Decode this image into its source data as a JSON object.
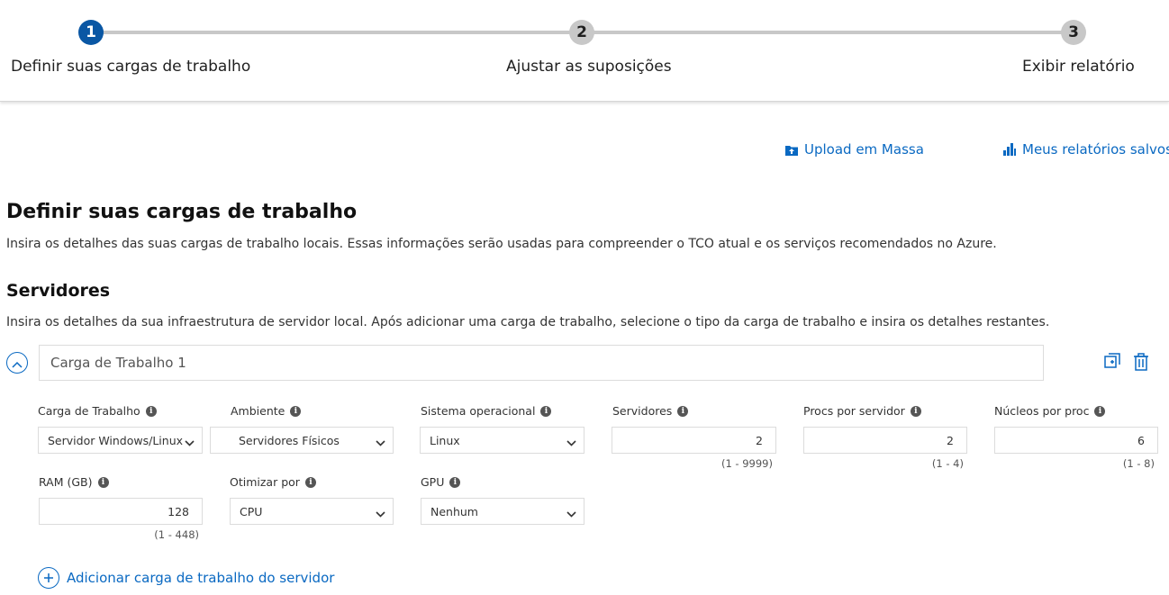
{
  "stepper": {
    "steps": [
      {
        "number": "1",
        "label": "Definir suas cargas de trabalho",
        "state": "active"
      },
      {
        "number": "2",
        "label": "Ajustar as suposições",
        "state": "inactive"
      },
      {
        "number": "3",
        "label": "Exibir relatório",
        "state": "inactive"
      }
    ]
  },
  "links": {
    "bulk_upload": "Upload em Massa",
    "saved_reports": "Meus relatórios salvos"
  },
  "page": {
    "title": "Definir suas cargas de trabalho",
    "description": "Insira os detalhes das suas cargas de trabalho locais. Essas informações serão usadas para compreender o TCO atual e os serviços recomendados no Azure."
  },
  "servers": {
    "title": "Servidores",
    "description": "Insira os detalhes da sua infraestrutura de servidor local. Após adicionar uma carga de trabalho, selecione o tipo da carga de trabalho e insira os detalhes restantes.",
    "workload_name": "Carga de Trabalho 1",
    "fields": {
      "workload": {
        "label": "Carga de Trabalho",
        "value": "Servidor Windows/Linux"
      },
      "environment": {
        "label": "Ambiente",
        "value": "Servidores Físicos"
      },
      "os": {
        "label": "Sistema operacional",
        "value": "Linux"
      },
      "servers": {
        "label": "Servidores",
        "value": "2",
        "range": "(1 - 9999)"
      },
      "procs": {
        "label": "Procs por servidor",
        "value": "2",
        "range": "(1 - 4)"
      },
      "cores": {
        "label": "Núcleos por proc",
        "value": "6",
        "range": "(1 - 8)"
      },
      "ram": {
        "label": "RAM (GB)",
        "value": "128",
        "range": "(1 - 448)"
      },
      "optimize": {
        "label": "Otimizar por",
        "value": "CPU"
      },
      "gpu": {
        "label": "GPU",
        "value": "Nenhum"
      }
    },
    "add_label": "Adicionar carga de trabalho do servidor"
  },
  "colors": {
    "accent": "#0a57a4",
    "link": "#0a69c2",
    "step_inactive": "#c8c8c8"
  }
}
